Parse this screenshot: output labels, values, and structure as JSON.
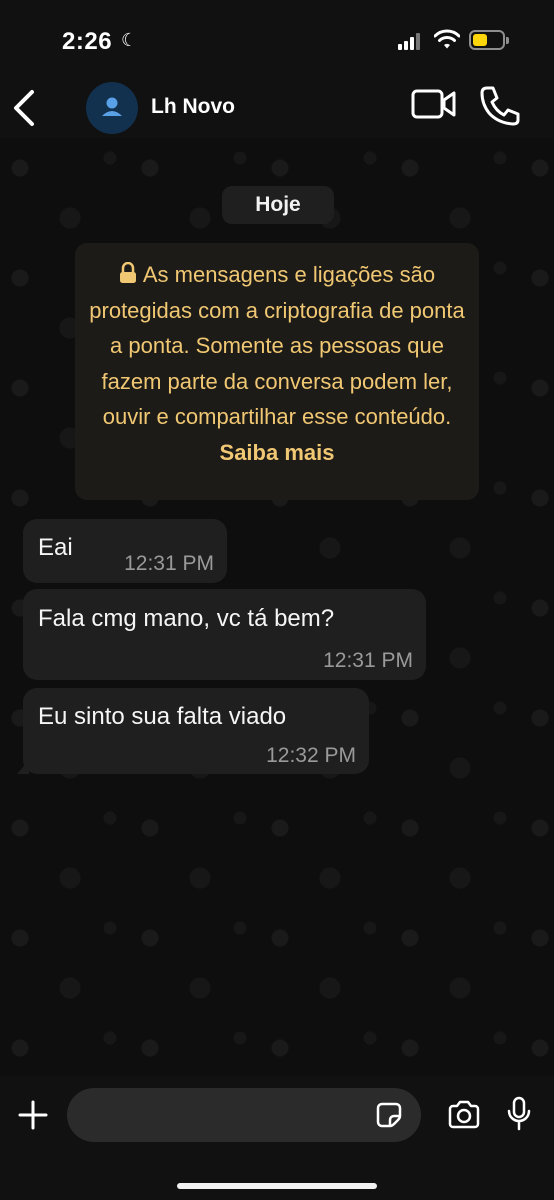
{
  "status_bar": {
    "time": "2:26",
    "icons": [
      "moon-icon",
      "signal-icon",
      "wifi-icon",
      "battery-icon"
    ],
    "battery_color": "#ffd60a"
  },
  "header": {
    "contact_name": "Lh Novo",
    "icons": [
      "back-icon",
      "avatar-icon",
      "video-call-icon",
      "phone-call-icon"
    ]
  },
  "chat": {
    "day_label": "Hoje",
    "encryption_notice": {
      "text": "As mensagens e ligações são protegidas com a criptografia de ponta a ponta. Somente as pessoas que fazem parte da conversa podem ler, ouvir e compartilhar esse conteúdo.",
      "link": "Saiba mais",
      "color": "#f0c773"
    },
    "messages": [
      {
        "text": "Eai",
        "time": "12:31 PM"
      },
      {
        "text": "Fala cmg mano, vc tá bem?",
        "time": "12:31 PM"
      },
      {
        "text": "Eu sinto sua falta viado",
        "time": "12:32 PM"
      }
    ]
  },
  "composer": {
    "value": "",
    "icons": [
      "plus-icon",
      "sticker-icon",
      "camera-icon",
      "microphone-icon"
    ]
  }
}
